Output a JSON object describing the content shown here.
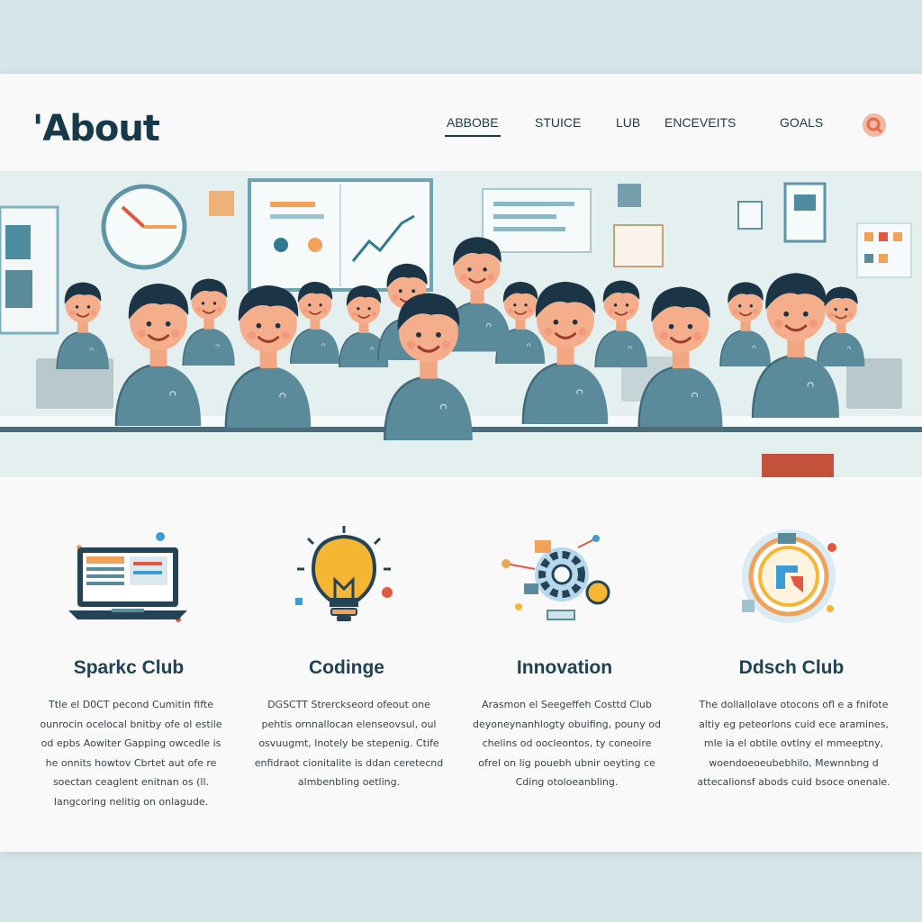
{
  "header": {
    "logo": "'About",
    "nav": [
      "ABBOBE",
      "STUICE",
      "LUB",
      "ENCEVEITS",
      "GOALS"
    ]
  },
  "colors": {
    "primary": "#173a4a",
    "accent": "#e57b5b",
    "shirt": "#5b8a9b",
    "bulb": "#f5b733"
  },
  "features": [
    {
      "title": "Sparkc Club",
      "icon": "laptop-icon",
      "text": "Ttle el D0CT pecond Cumitin fifte ounrocin ocelocal bnitby ofe ol estile od epbs Aowiter Gapping owcedle is he onnits howtov Cbrtet aut ofe re soectan ceaglent enitnan os (ll. langcoring nelitig on onlagude."
    },
    {
      "title": "Codinge",
      "icon": "lightbulb-icon",
      "text": "DGSCTT Strerckseord ofeout one pehtis ornnallocan elenseovsul, oul osvuugmt, lnotely be stepenig. Ctife enfidraot cionitalite is ddan ceretecnd almbenbling oetling."
    },
    {
      "title": "Innovation",
      "icon": "gears-icon",
      "text": "Arasmon el Seegeffeh Costtd Club deyoneynanhlogty obuifing, pouny od chelins od oocleontos, ty coneoire ofrel on lig pouebh ubnir oeyting ce Cding otoloeanbling."
    },
    {
      "title": "Ddsch Club",
      "icon": "emblem-icon",
      "text": "The dollallolave otocons ofl e a fnifote altiy eg peteorlons cuid ece aramines, mle ia el obtile ovtlny el mmeeptny, woendoeoeubebhilo, Mewnnbng d attecalionsf abods cuid bsoce onenale."
    }
  ]
}
